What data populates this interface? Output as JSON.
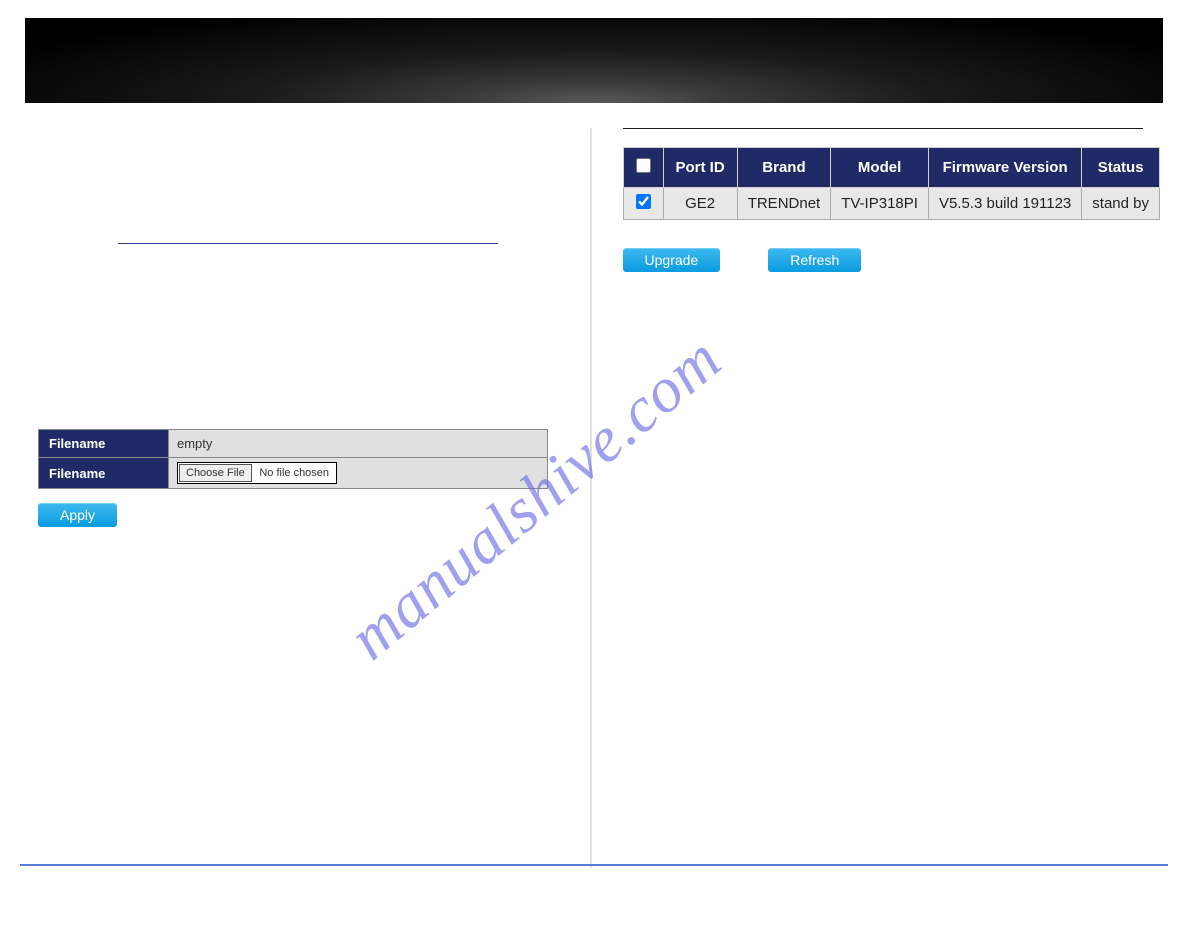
{
  "watermark_text": "manualshive.com",
  "left_panel": {
    "row1_label": "Filename",
    "row1_value": "empty",
    "row2_label": "Filename",
    "choose_file_btn": "Choose File",
    "no_file_text": "No file chosen",
    "apply_btn": "Apply"
  },
  "right_panel": {
    "headers": {
      "checkbox": "",
      "port_id": "Port ID",
      "brand": "Brand",
      "model": "Model",
      "firmware": "Firmware Version",
      "status": "Status"
    },
    "row": {
      "checked": true,
      "port_id": "GE2",
      "brand": "TRENDnet",
      "model": "TV-IP318PI",
      "firmware": "V5.5.3 build 191123",
      "status": "stand by"
    },
    "upgrade_btn": "Upgrade",
    "refresh_btn": "Refresh"
  }
}
